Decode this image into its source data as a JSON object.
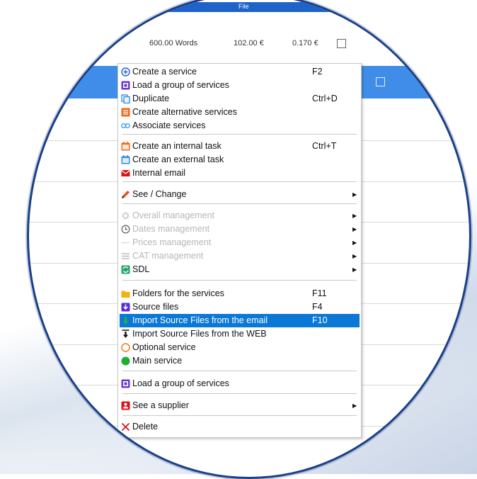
{
  "background_row": {
    "top_strip_text": "File",
    "words": "600.00 Words",
    "price": "102.00 €",
    "unit_price": "0.170 €"
  },
  "menu": {
    "items": [
      {
        "label": "Create a service",
        "shortcut": "F2",
        "icon": "plus-circle-icon"
      },
      {
        "label": "Load a group of services",
        "shortcut": "",
        "icon": "load-group-icon"
      },
      {
        "label": "Duplicate",
        "shortcut": "Ctrl+D",
        "icon": "duplicate-icon"
      },
      {
        "label": "Create alternative services",
        "shortcut": "",
        "icon": "alternative-icon"
      },
      {
        "label": "Associate services",
        "shortcut": "",
        "icon": "link-icon"
      },
      {
        "label": "Create an internal task",
        "shortcut": "Ctrl+T",
        "icon": "internal-task-icon"
      },
      {
        "label": "Create an external task",
        "shortcut": "",
        "icon": "external-task-icon"
      },
      {
        "label": "Internal email",
        "shortcut": "",
        "icon": "email-icon"
      },
      {
        "label": "See / Change",
        "shortcut": "",
        "icon": "pencil-icon",
        "submenu": true
      },
      {
        "label": "Overall management",
        "shortcut": "",
        "icon": "gear-icon",
        "submenu": true,
        "disabled": true
      },
      {
        "label": "Dates management",
        "shortcut": "",
        "icon": "clock-icon",
        "submenu": true,
        "disabled": true
      },
      {
        "label": "Prices management",
        "shortcut": "",
        "icon": "price-icon",
        "submenu": true,
        "disabled": true
      },
      {
        "label": "CAT management",
        "shortcut": "",
        "icon": "list-icon",
        "submenu": true,
        "disabled": true
      },
      {
        "label": "SDL",
        "shortcut": "",
        "icon": "sdl-icon",
        "submenu": true
      },
      {
        "label": "Folders for the services",
        "shortcut": "F11",
        "icon": "folder-icon"
      },
      {
        "label": "Source files",
        "shortcut": "F4",
        "icon": "source-files-icon"
      },
      {
        "label": "Import Source Files from the email",
        "shortcut": "F10",
        "icon": "import-email-icon",
        "highlighted": true
      },
      {
        "label": "Import Source Files from the WEB",
        "shortcut": "",
        "icon": "import-web-icon"
      },
      {
        "label": "Optional service",
        "shortcut": "",
        "icon": "optional-circle-icon"
      },
      {
        "label": "Main service",
        "shortcut": "",
        "icon": "main-circle-icon"
      },
      {
        "label": "Load a group of services",
        "shortcut": "",
        "icon": "load-group-icon"
      },
      {
        "label": "See a supplier",
        "shortcut": "",
        "icon": "supplier-icon",
        "submenu": true
      },
      {
        "label": "Delete",
        "shortcut": "",
        "icon": "delete-x-icon"
      }
    ]
  },
  "colors": {
    "highlight": "#0a78d7",
    "accent_blue": "#3f8de8",
    "border_navy": "#1b3f86"
  }
}
